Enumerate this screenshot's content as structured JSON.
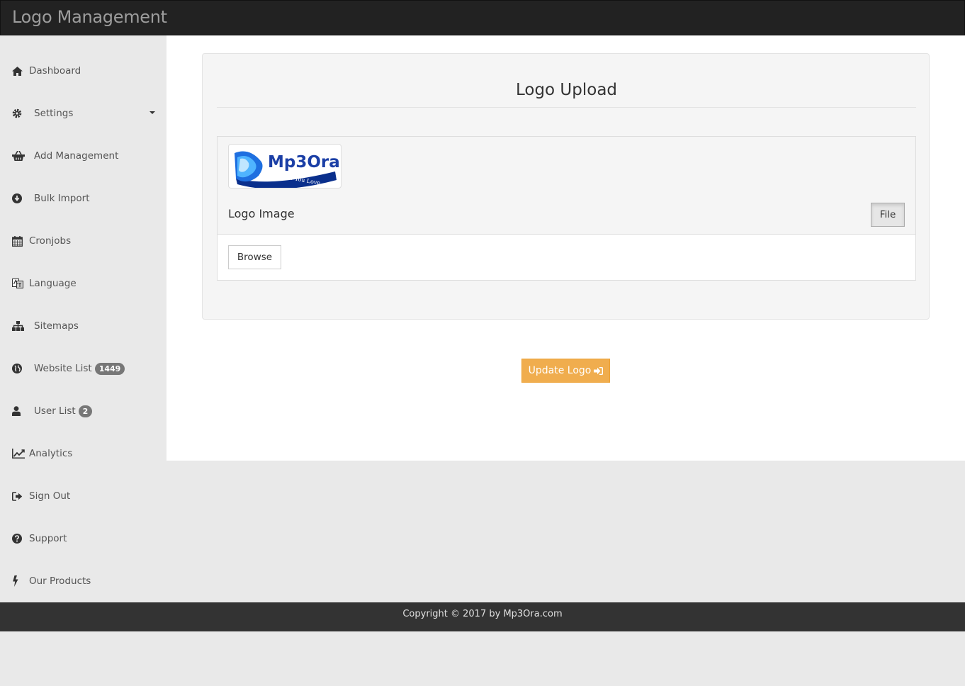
{
  "header": {
    "brand": "Logo Management"
  },
  "sidebar": {
    "items": [
      {
        "label": "Dashboard",
        "icon": "home-icon"
      },
      {
        "label": "Settings",
        "icon": "gear-icon",
        "dropdown": true
      },
      {
        "label": "Add Management",
        "icon": "basket-icon"
      },
      {
        "label": "Bulk Import",
        "icon": "download-circle-icon"
      },
      {
        "label": "Cronjobs",
        "icon": "calendar-icon"
      },
      {
        "label": "Language",
        "icon": "language-icon"
      },
      {
        "label": "Sitemaps",
        "icon": "sitemap-icon"
      },
      {
        "label": "Website List",
        "icon": "globe-icon",
        "badge": "1449"
      },
      {
        "label": "User List",
        "icon": "user-icon",
        "badge": "2"
      },
      {
        "label": "Analytics",
        "icon": "line-chart-icon"
      },
      {
        "label": "Sign Out",
        "icon": "sign-out-icon"
      },
      {
        "label": "Support",
        "icon": "question-circle-icon"
      },
      {
        "label": "Our Products",
        "icon": "bolt-icon"
      }
    ]
  },
  "main": {
    "title": "Logo Upload",
    "logo_text": "Mp3Ora",
    "logo_tagline": "Music You Love",
    "panel_title": "Logo Image",
    "file_label": "File",
    "browse_label": "Browse",
    "update_label": "Update Logo"
  },
  "footer": {
    "text": "Copyright © 2017 by Mp3Ora.com"
  },
  "colors": {
    "topbar": "#222222",
    "accent": "#f0ad4e",
    "badge": "#777777",
    "footer": "#333333"
  }
}
